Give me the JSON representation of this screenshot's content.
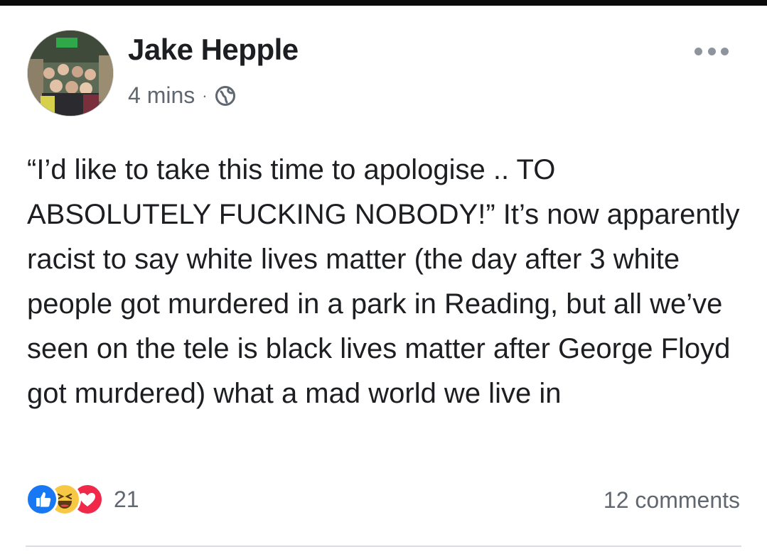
{
  "post": {
    "author": "Jake Hepple",
    "time": "4 mins",
    "separator": "·",
    "privacy_icon": "globe-icon",
    "text": "“I’d like to take this time to apologise .. TO ABSOLUTELY FUCKING NOBODY!” It’s now apparently racist to say white lives matter (the day after 3 white people got murdered in a park in Reading, but all we’ve seen on the tele is black lives matter after George Floyd got murdered) what a mad world we live in",
    "reactions": {
      "icons": [
        "like-icon",
        "haha-icon",
        "love-icon"
      ],
      "count": "21"
    },
    "comments": "12 comments"
  },
  "colors": {
    "like": "#1877f2",
    "haha": "#f7c843",
    "love": "#f0284a",
    "meta_text": "#606770",
    "body_text": "#1c1e21"
  }
}
